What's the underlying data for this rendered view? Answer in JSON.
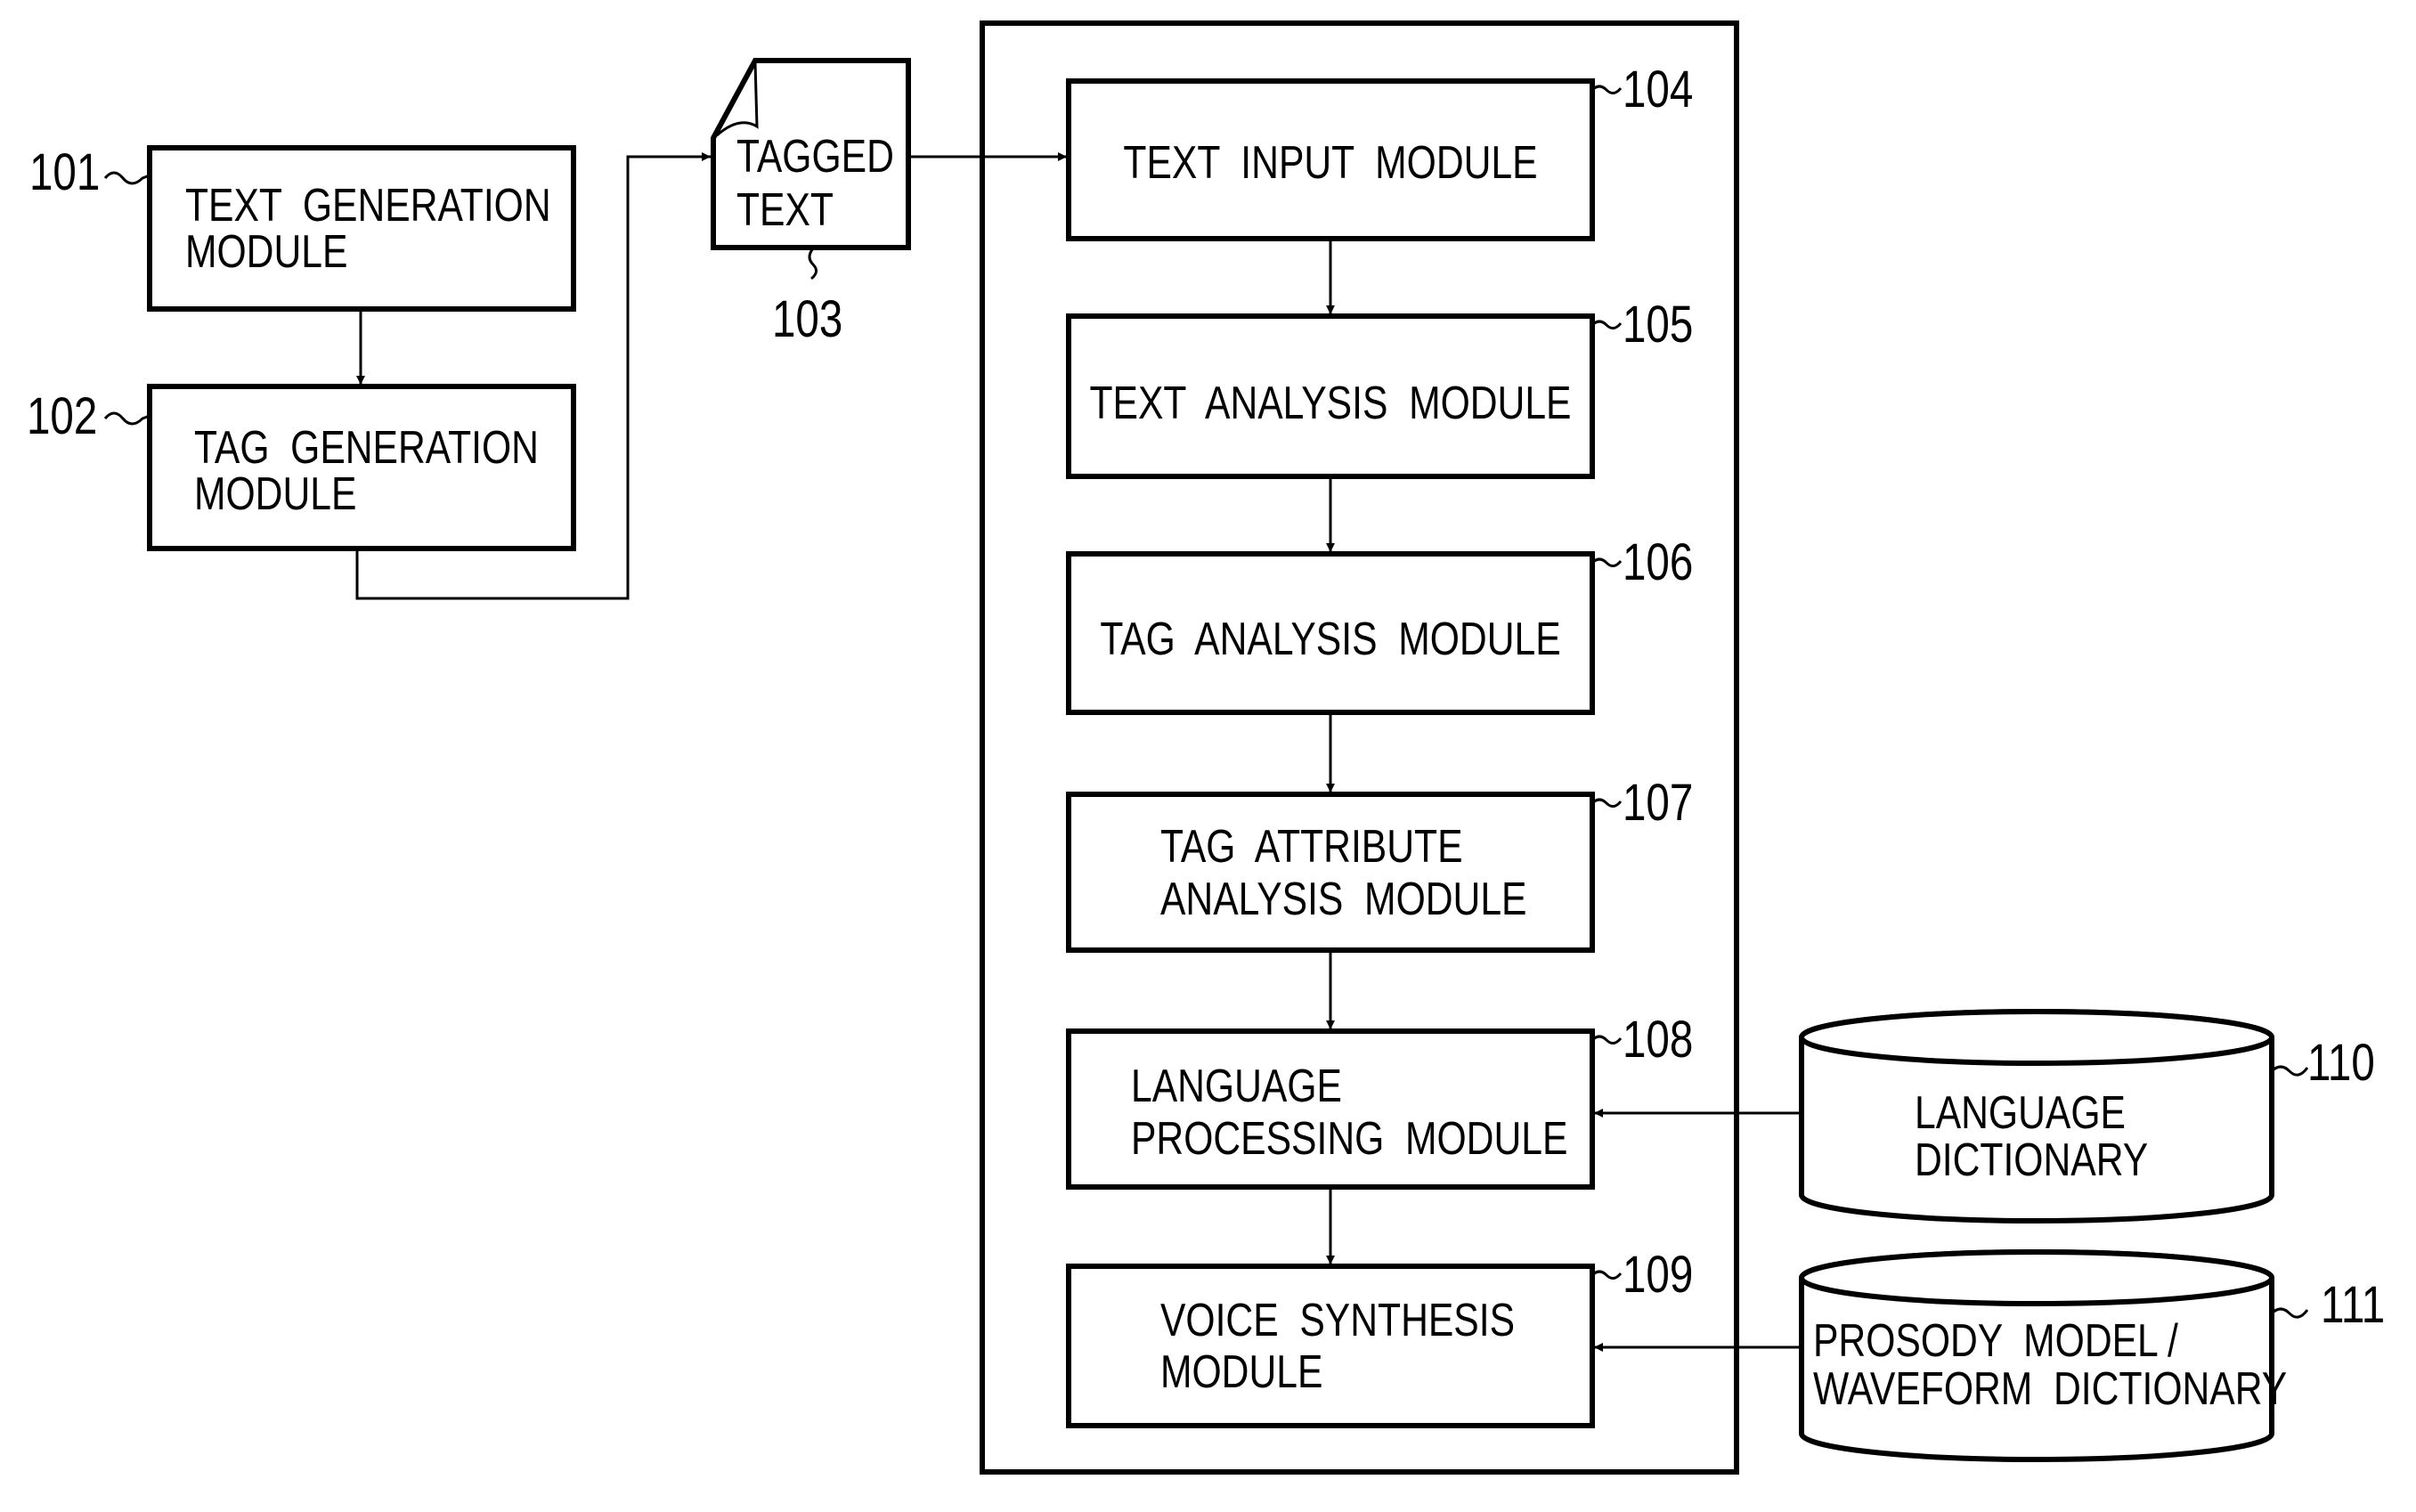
{
  "figure": {
    "external": {
      "text_generation": {
        "ref": "101",
        "lines": [
          "TEXT  GENERATION",
          "MODULE"
        ]
      },
      "tag_generation": {
        "ref": "102",
        "lines": [
          "TAG  GENERATION",
          "MODULE"
        ]
      },
      "tagged_text": {
        "ref": "103",
        "lines": [
          "TAGGED",
          "TEXT"
        ]
      }
    },
    "modules": [
      {
        "ref": "104",
        "lines": [
          "TEXT  INPUT  MODULE"
        ]
      },
      {
        "ref": "105",
        "lines": [
          "TEXT  ANALYSIS  MODULE"
        ]
      },
      {
        "ref": "106",
        "lines": [
          "TAG  ANALYSIS  MODULE"
        ]
      },
      {
        "ref": "107",
        "lines": [
          "TAG  ATTRIBUTE",
          "ANALYSIS  MODULE"
        ]
      },
      {
        "ref": "108",
        "lines": [
          "LANGUAGE",
          "PROCESSING  MODULE"
        ]
      },
      {
        "ref": "109",
        "lines": [
          "VOICE  SYNTHESIS",
          "MODULE"
        ]
      }
    ],
    "databases": [
      {
        "ref": "110",
        "lines": [
          "LANGUAGE",
          "DICTIONARY"
        ]
      },
      {
        "ref": "111",
        "lines": [
          "PROSODY  MODEL /",
          "WAVEFORM  DICTIONARY"
        ]
      }
    ]
  }
}
